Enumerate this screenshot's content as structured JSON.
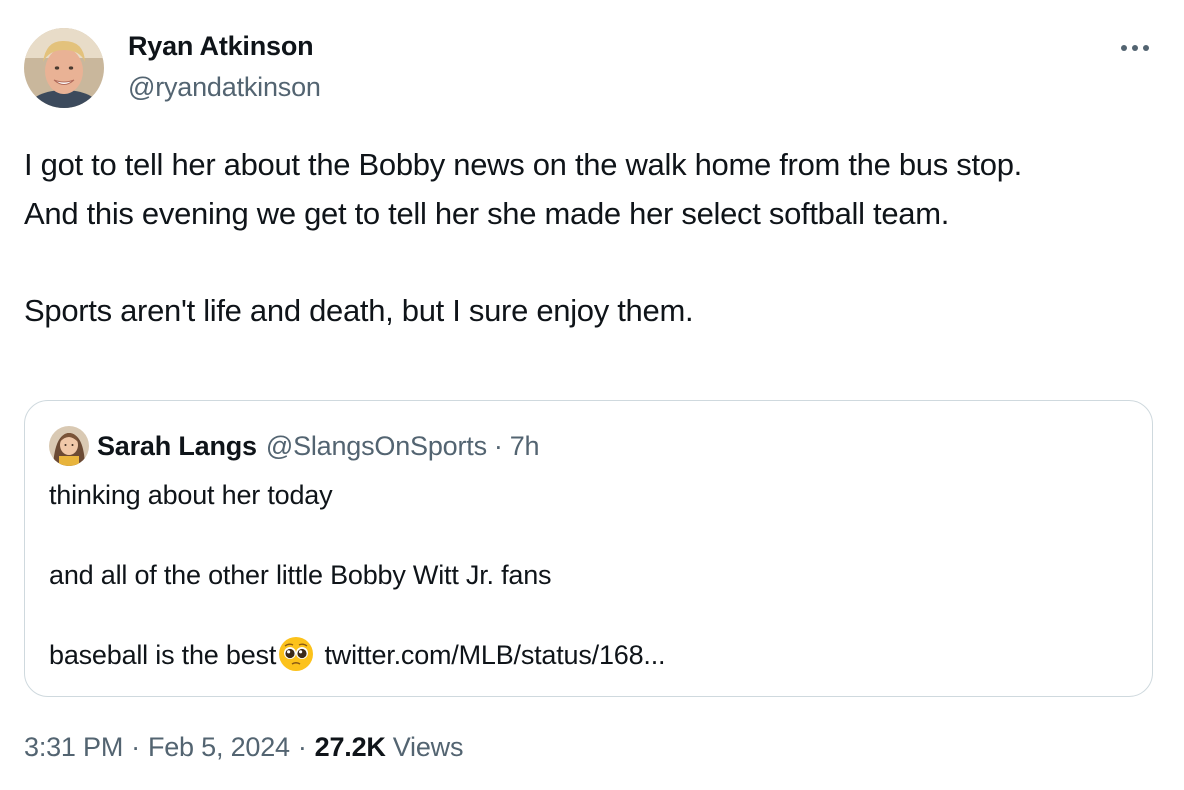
{
  "author": {
    "name": "Ryan Atkinson",
    "handle": "@ryandatkinson"
  },
  "more_icon": "more-horizontal-icon",
  "tweet": {
    "lines": [
      "I got to tell her about the Bobby news on the walk home from the bus stop.",
      "And this evening we get to tell her she made her select softball team.",
      "",
      "Sports aren't life and death, but I sure enjoy them."
    ]
  },
  "quote": {
    "name": "Sarah Langs",
    "handle": "@SlangsOnSports",
    "separator": "·",
    "time": "7h",
    "lines": [
      "thinking about her today",
      "",
      "and all of the other little Bobby Witt Jr. fans",
      ""
    ],
    "last_line_text": "baseball is the best",
    "emoji": "pleading-face-emoji",
    "link": "twitter.com/MLB/status/168..."
  },
  "meta": {
    "time": "3:31 PM",
    "separator": "·",
    "date": "Feb 5, 2024",
    "views_count": "27.2K",
    "views_label": "Views"
  },
  "colors": {
    "text_primary": "#0f1419",
    "text_secondary": "#536471",
    "border": "#cfd9de",
    "background": "#ffffff"
  }
}
